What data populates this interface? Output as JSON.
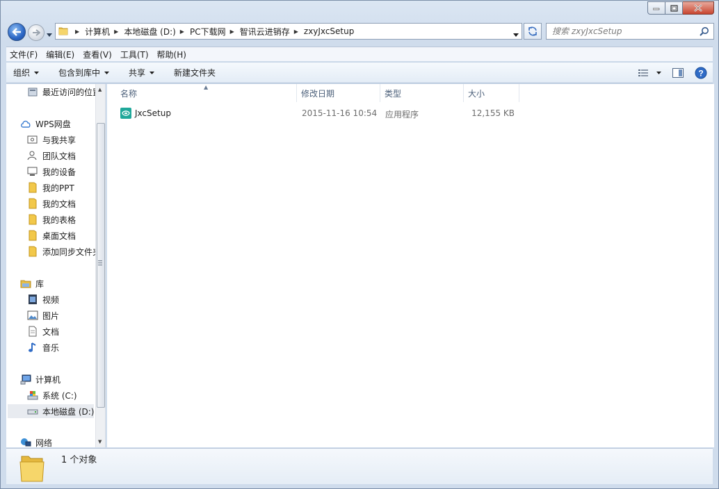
{
  "window": {
    "title": "zxyJxcSetup",
    "accent": "#2b66c4"
  },
  "address": {
    "crumbs": [
      "计算机",
      "本地磁盘 (D:)",
      "PC下载网",
      "智讯云进销存",
      "zxyJxcSetup"
    ]
  },
  "search": {
    "placeholder": "搜索 zxyJxcSetup"
  },
  "menu": [
    "文件(F)",
    "编辑(E)",
    "查看(V)",
    "工具(T)",
    "帮助(H)"
  ],
  "commands": {
    "organize": "组织",
    "include_library": "包含到库中",
    "share": "共享",
    "new_folder": "新建文件夹"
  },
  "nav": {
    "recent": "最近访问的位置",
    "wps": "WPS网盘",
    "shared_with_me": "与我共享",
    "team_docs": "团队文档",
    "my_devices": "我的设备",
    "my_ppt": "我的PPT",
    "my_docs": "我的文档",
    "my_sheets": "我的表格",
    "desktop_docs": "桌面文档",
    "add_sync": "添加同步文件夹",
    "libraries": "库",
    "videos": "视频",
    "pictures": "图片",
    "documents": "文档",
    "music": "音乐",
    "computer": "计算机",
    "drive_c": "系统 (C:)",
    "drive_d": "本地磁盘 (D:)",
    "network": "网络"
  },
  "columns": {
    "name": "名称",
    "modified": "修改日期",
    "type": "类型",
    "size": "大小"
  },
  "files": [
    {
      "name": "JxcSetup",
      "icon": "setup-app-icon",
      "modified": "2015-11-16 10:54",
      "type": "应用程序",
      "size": "12,155 KB"
    }
  ],
  "details": {
    "count": "1 个对象"
  }
}
